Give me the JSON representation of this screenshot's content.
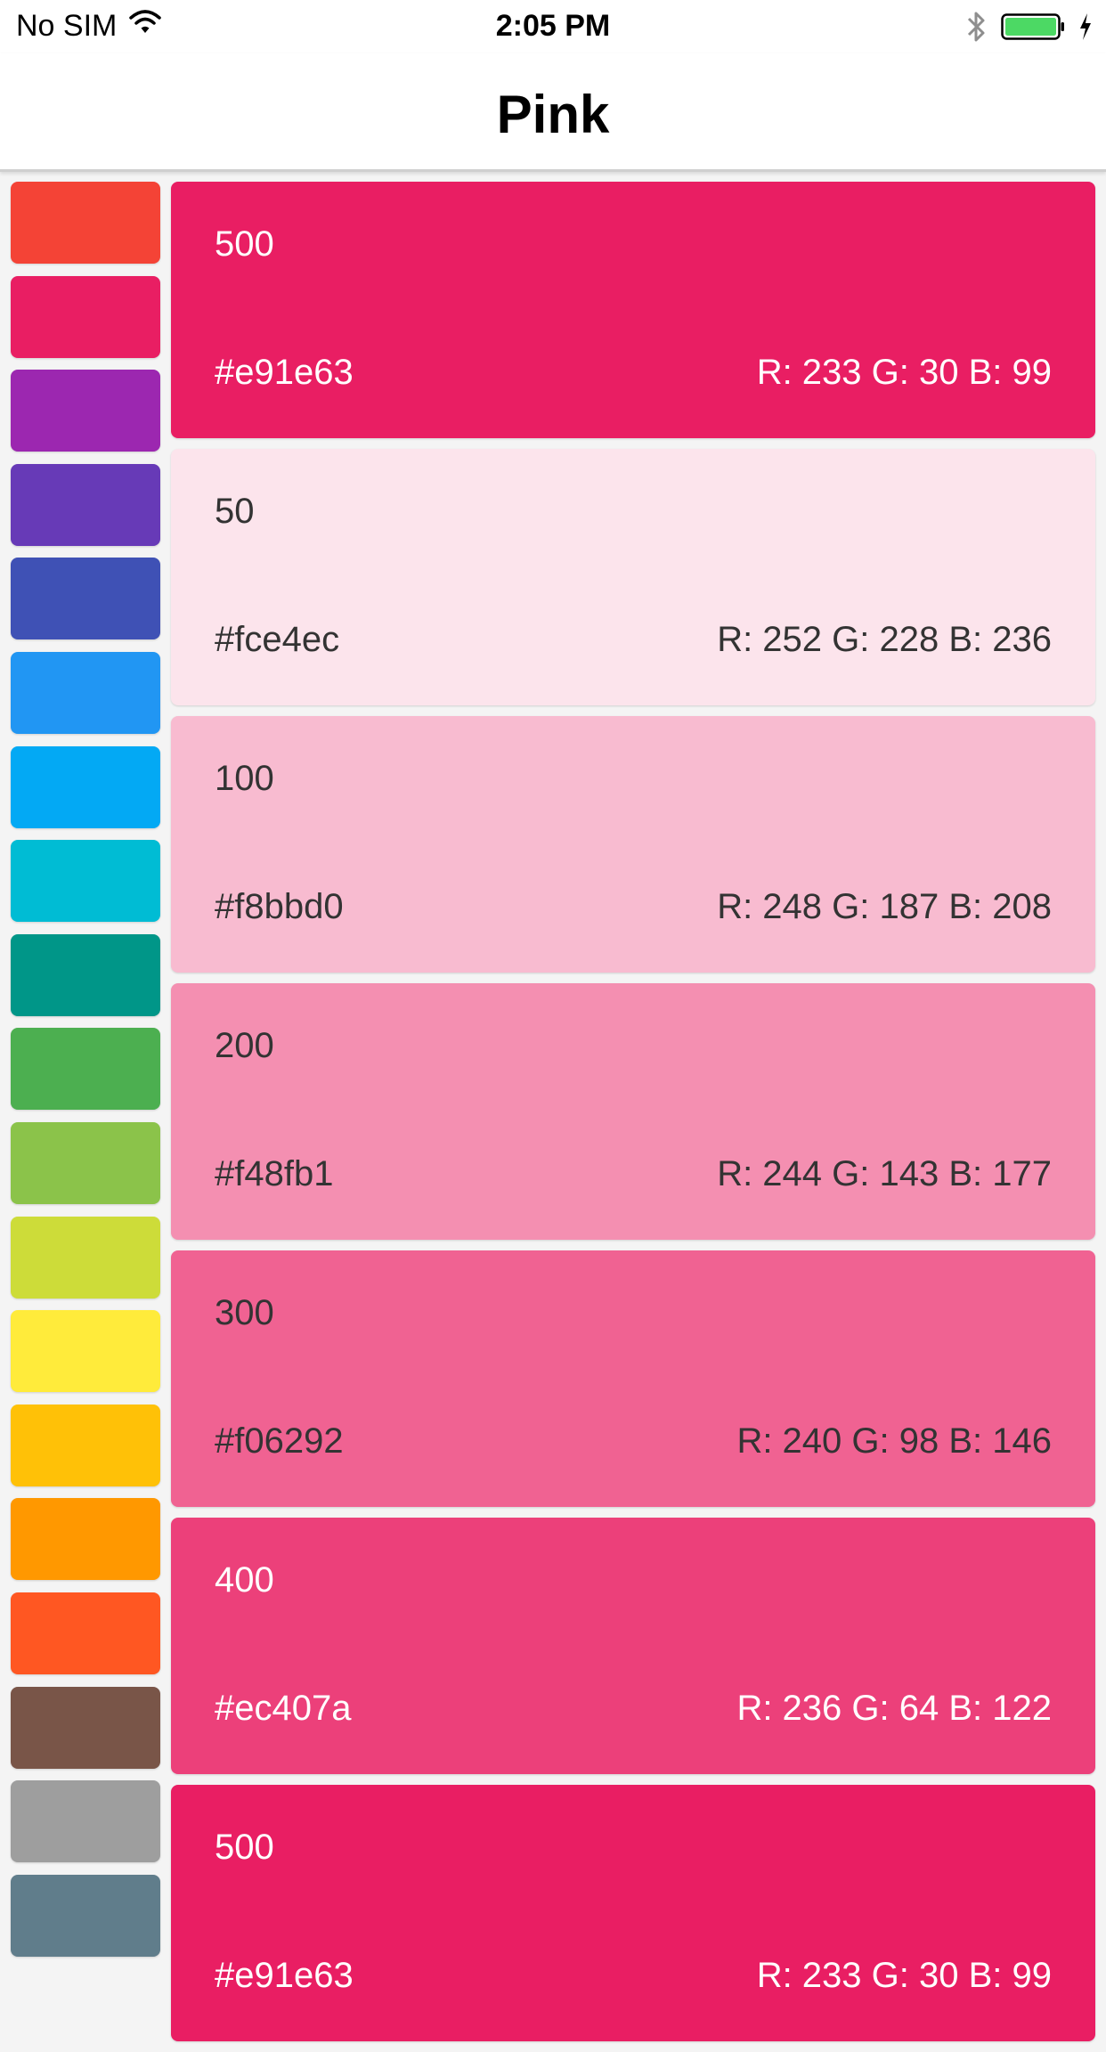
{
  "status_bar": {
    "carrier": "No SIM",
    "time": "2:05 PM"
  },
  "nav": {
    "title": "Pink"
  },
  "sidebar": {
    "swatches": [
      {
        "color": "#f44336"
      },
      {
        "color": "#e91e63"
      },
      {
        "color": "#9c27b0"
      },
      {
        "color": "#673ab7"
      },
      {
        "color": "#3f51b5"
      },
      {
        "color": "#2196f3"
      },
      {
        "color": "#03a9f4"
      },
      {
        "color": "#00bcd4"
      },
      {
        "color": "#009688"
      },
      {
        "color": "#4caf50"
      },
      {
        "color": "#8bc34a"
      },
      {
        "color": "#cddc39"
      },
      {
        "color": "#ffeb3b"
      },
      {
        "color": "#ffc107"
      },
      {
        "color": "#ff9800"
      },
      {
        "color": "#ff5722"
      },
      {
        "color": "#795548"
      },
      {
        "color": "#9e9e9e"
      },
      {
        "color": "#607d8b"
      }
    ]
  },
  "cards": [
    {
      "shade": "500",
      "hex": "#e91e63",
      "rgb": "R: 233 G: 30 B: 99",
      "bg": "#e91e63",
      "text_color": "#ffffff"
    },
    {
      "shade": "50",
      "hex": "#fce4ec",
      "rgb": "R: 252 G: 228 B: 236",
      "bg": "#fce4ec",
      "text_color": "#333333"
    },
    {
      "shade": "100",
      "hex": "#f8bbd0",
      "rgb": "R: 248 G: 187 B: 208",
      "bg": "#f8bbd0",
      "text_color": "#333333"
    },
    {
      "shade": "200",
      "hex": "#f48fb1",
      "rgb": "R: 244 G: 143 B: 177",
      "bg": "#f48fb1",
      "text_color": "#333333"
    },
    {
      "shade": "300",
      "hex": "#f06292",
      "rgb": "R: 240 G: 98 B: 146",
      "bg": "#f06292",
      "text_color": "#333333"
    },
    {
      "shade": "400",
      "hex": "#ec407a",
      "rgb": "R: 236 G: 64 B: 122",
      "bg": "#ec407a",
      "text_color": "#ffffff"
    },
    {
      "shade": "500",
      "hex": "#e91e63",
      "rgb": "R: 233 G: 30 B: 99",
      "bg": "#e91e63",
      "text_color": "#ffffff"
    }
  ]
}
